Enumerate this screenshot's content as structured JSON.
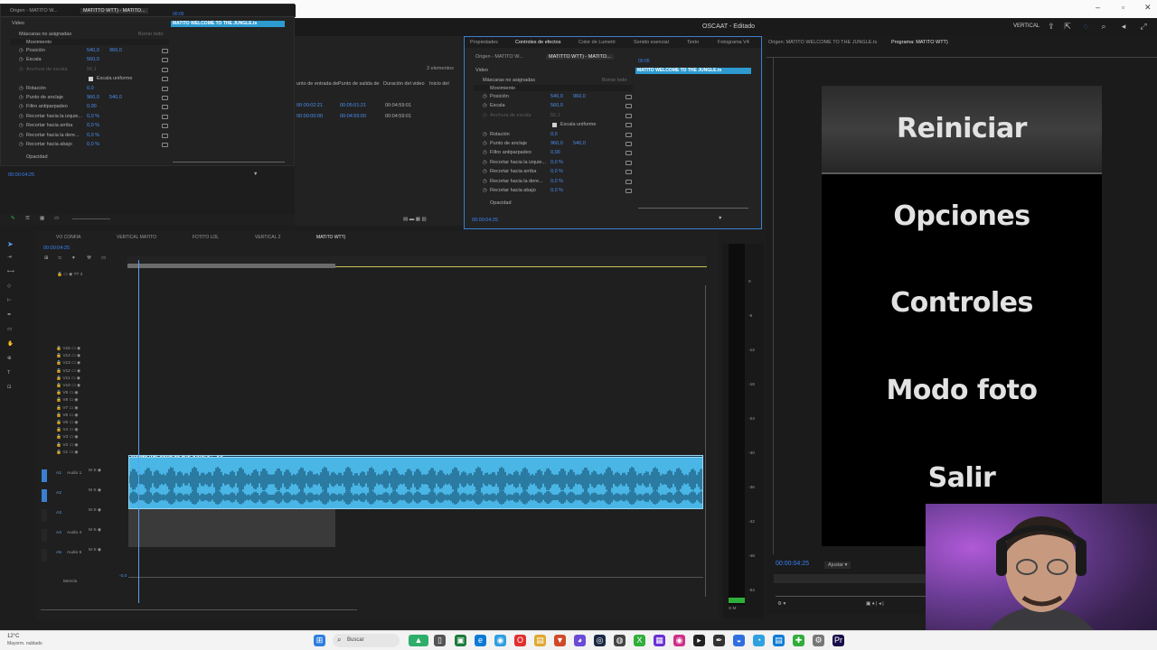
{
  "window": {
    "app_title": "OSCAAT - Editado",
    "workspace": "VERTICAL"
  },
  "effects_source_left": {
    "tab_origin": "Origen - MATITO W...",
    "tab_sequence": "MATITTO WTT) - MATITO...",
    "clip_label": "MATITO WELCOME TO THE JUNGLE.ts",
    "section_video": "Video",
    "masks": "Máscaras no asignadas",
    "clear_all": "Borrar todo",
    "motion": "Movimiento",
    "rows": [
      {
        "label": "Posición",
        "v1": "540,0",
        "v2": "960,0"
      },
      {
        "label": "Escala",
        "v1": "560,0",
        "v2": ""
      },
      {
        "label": "Anchura de escala",
        "v1": "56,1",
        "v2": ""
      },
      {
        "label": "Escala uniforme",
        "v1": "",
        "v2": ""
      },
      {
        "label": "Rotación",
        "v1": "0,0",
        "v2": ""
      },
      {
        "label": "Punto de anclaje",
        "v1": "960,0",
        "v2": "540,0"
      },
      {
        "label": "Filtro antiparpadeo",
        "v1": "0,00",
        "v2": ""
      },
      {
        "label": "Recortar hacia la izquie...",
        "v1": "0,0 %",
        "v2": ""
      },
      {
        "label": "Recortar hacia arriba",
        "v1": "0,0 %",
        "v2": ""
      },
      {
        "label": "Recortar hacia la dere...",
        "v1": "0,0 %",
        "v2": ""
      },
      {
        "label": "Recortar hacia abajo",
        "v1": "0,0 %",
        "v2": ""
      }
    ],
    "opacity": "Opacidad",
    "timecode": "00:00:04:25",
    "mini_tc": "00:05"
  },
  "project_list": {
    "count": "3 elementos",
    "headers": [
      "unto de entrada del",
      "Punto de salida de",
      "Duración del video",
      "Inicio del"
    ],
    "rows": [
      [
        "00:00:02:21",
        "00:05:01:21",
        "00:04:59:01"
      ],
      [
        "00:00:00:00",
        "00:04:59:00",
        "00:04:59:01"
      ]
    ]
  },
  "effects_panel": {
    "tabs": [
      "Propiedades",
      "Controles de efectos",
      "Color de Lumetri",
      "Sonido esencial",
      "Texto",
      "Fotograma V4"
    ],
    "tab_origin": "Origen - MATITO W...",
    "tab_sequence": "MATITTO WTT) - MATITO...",
    "clip_label": "MATITO WELCOME TO THE JUNGLE.ts",
    "section_video": "Video",
    "masks": "Máscaras no asignadas",
    "clear_all": "Borrar todo",
    "motion": "Movimiento",
    "rows": [
      {
        "label": "Posición",
        "v1": "540,0",
        "v2": "960,0"
      },
      {
        "label": "Escala",
        "v1": "560,0",
        "v2": ""
      },
      {
        "label": "Anchura de escala",
        "v1": "56,1",
        "v2": ""
      },
      {
        "label": "Escala uniforme",
        "v1": "",
        "v2": ""
      },
      {
        "label": "Rotación",
        "v1": "0,0",
        "v2": ""
      },
      {
        "label": "Punto de anclaje",
        "v1": "960,0",
        "v2": "540,0"
      },
      {
        "label": "Filtro antiparpadeo",
        "v1": "0,00",
        "v2": ""
      },
      {
        "label": "Recortar hacia la izquie...",
        "v1": "0,0 %",
        "v2": ""
      },
      {
        "label": "Recortar hacia arriba",
        "v1": "0,0 %",
        "v2": ""
      },
      {
        "label": "Recortar hacia la dere...",
        "v1": "0,0 %",
        "v2": ""
      },
      {
        "label": "Recortar hacia abajo",
        "v1": "0,0 %",
        "v2": ""
      }
    ],
    "opacity": "Opacidad",
    "timecode": "00:00:04:25",
    "mini_tc": "00:05"
  },
  "timeline": {
    "tabs": [
      "VO CONFIA",
      "VERTICAL MATITO",
      "FOTITO LOL",
      "VERTICAL 2",
      "MATITO WTT)"
    ],
    "active_tab": "MATITO WTT)",
    "timecode": "00:00:04:25",
    "video_tracks": [
      "V15",
      "V14",
      "V13",
      "V12",
      "V11",
      "V10",
      "V9",
      "V8",
      "V7",
      "V6",
      "V5",
      "V4",
      "V3",
      "V2",
      "V1"
    ],
    "top_track": "TT 2",
    "audio_tracks": [
      {
        "id": "A1",
        "name": "Audio 1"
      },
      {
        "id": "A2",
        "name": ""
      },
      {
        "id": "A3",
        "name": ""
      },
      {
        "id": "A4",
        "name": "Audio 4"
      },
      {
        "id": "A5",
        "name": "Audio 5"
      }
    ],
    "mix_label": "Mezcla",
    "mix_value": "-0,0",
    "video_clip": "MATITO WELCOME TO THE JUNGLE.ts [V]",
    "audio_clip_fx": "fx"
  },
  "meter": {
    "labels": [
      "0",
      "-6",
      "-12",
      "-18",
      "-24",
      "-30",
      "-36",
      "-42",
      "-48",
      "-54"
    ],
    "sm": "S M"
  },
  "program": {
    "title": "Programa: MATITO WTT)",
    "source_tab": "Origen: MATITO WELCOME TO THE JUNGLE.ts",
    "menu": [
      "Reiniciar",
      "Opciones",
      "Controles",
      "Modo foto",
      "Salir"
    ],
    "timecode": "00:00:04:25",
    "fit": "Ajustar"
  },
  "taskbar": {
    "weather_temp": "12°C",
    "weather_desc": "Mayorm. nublado",
    "search": "Buscar"
  }
}
